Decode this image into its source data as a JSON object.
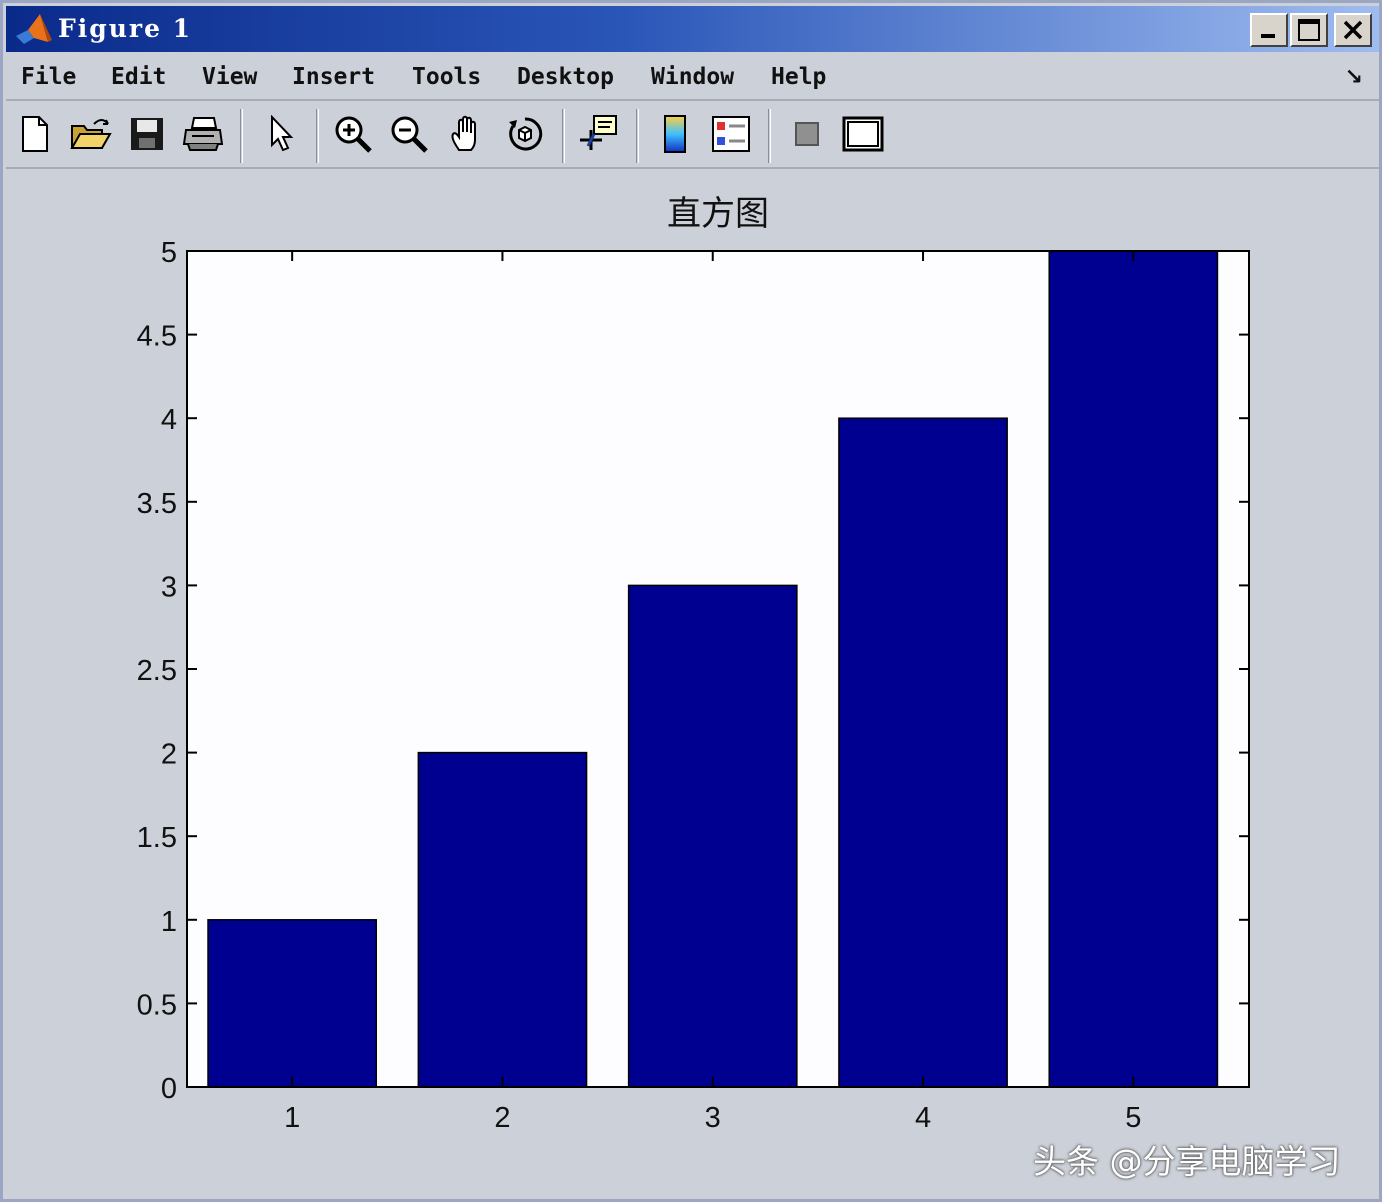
{
  "window": {
    "title": "Figure 1",
    "controls": [
      "minimize",
      "maximize",
      "close"
    ]
  },
  "menubar": {
    "items": [
      "File",
      "Edit",
      "View",
      "Insert",
      "Tools",
      "Desktop",
      "Window",
      "Help"
    ],
    "dock_icon": "↘"
  },
  "toolbar": {
    "buttons": [
      "new-figure-icon",
      "open-file-icon",
      "save-icon",
      "print-icon",
      "edit-plot-arrow-icon",
      "zoom-in-icon",
      "zoom-out-icon",
      "pan-hand-icon",
      "rotate-3d-icon",
      "data-cursor-icon",
      "colorbar-icon",
      "legend-icon",
      "hide-plot-tools-icon",
      "show-plot-tools-icon"
    ]
  },
  "colors": {
    "bar_fill": "#000090",
    "figure_bg": "#ccd0d8",
    "axes_bg": "#fdfdff"
  },
  "watermark": "头条 @分享电脑学习",
  "chart_data": {
    "type": "bar",
    "title": "直方图",
    "categories": [
      "1",
      "2",
      "3",
      "4",
      "5"
    ],
    "values": [
      1,
      2,
      3,
      4,
      5
    ],
    "ylim": [
      0,
      5
    ],
    "xlim": [
      0.5,
      5.55
    ],
    "yticks": [
      "0",
      "0.5",
      "1",
      "1.5",
      "2",
      "2.5",
      "3",
      "3.5",
      "4",
      "4.5",
      "5"
    ],
    "xlabel": "",
    "ylabel": "",
    "grid": false,
    "legend": "none"
  }
}
